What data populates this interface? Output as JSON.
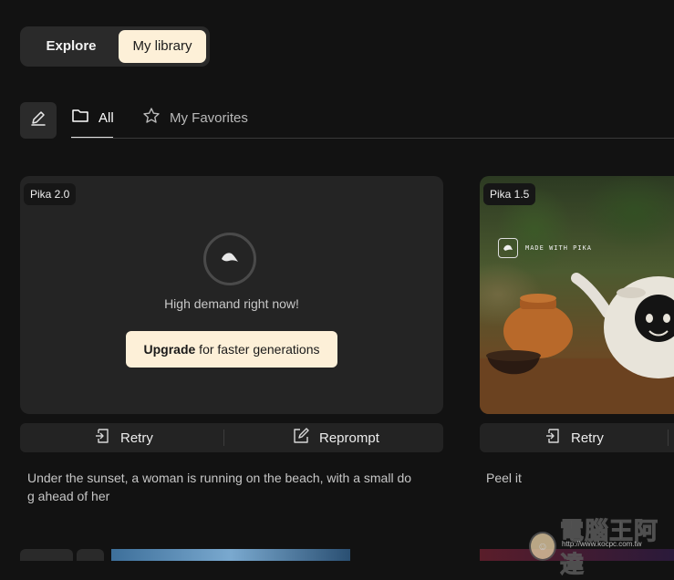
{
  "view_toggle": {
    "explore": "Explore",
    "library": "My library"
  },
  "tabs": {
    "all": "All",
    "favorites": "My Favorites"
  },
  "cards": [
    {
      "model": "Pika 2.0",
      "status": "High demand right now!",
      "upgrade_bold": "Upgrade",
      "upgrade_rest": " for faster generations",
      "retry": "Retry",
      "reprompt": "Reprompt",
      "prompt": "Under the sunset, a woman is running on the beach, with a small dog ahead of her"
    },
    {
      "model": "Pika 1.5",
      "watermark": "MADE WITH PIKA",
      "retry": "Retry",
      "prompt": "Peel it"
    }
  ],
  "site_watermark": {
    "text": "電腦王阿達",
    "url": "http://www.kocpc.com.tw"
  },
  "colors": {
    "background": "#121212",
    "accent": "#fdf0d8",
    "card": "#242424"
  }
}
